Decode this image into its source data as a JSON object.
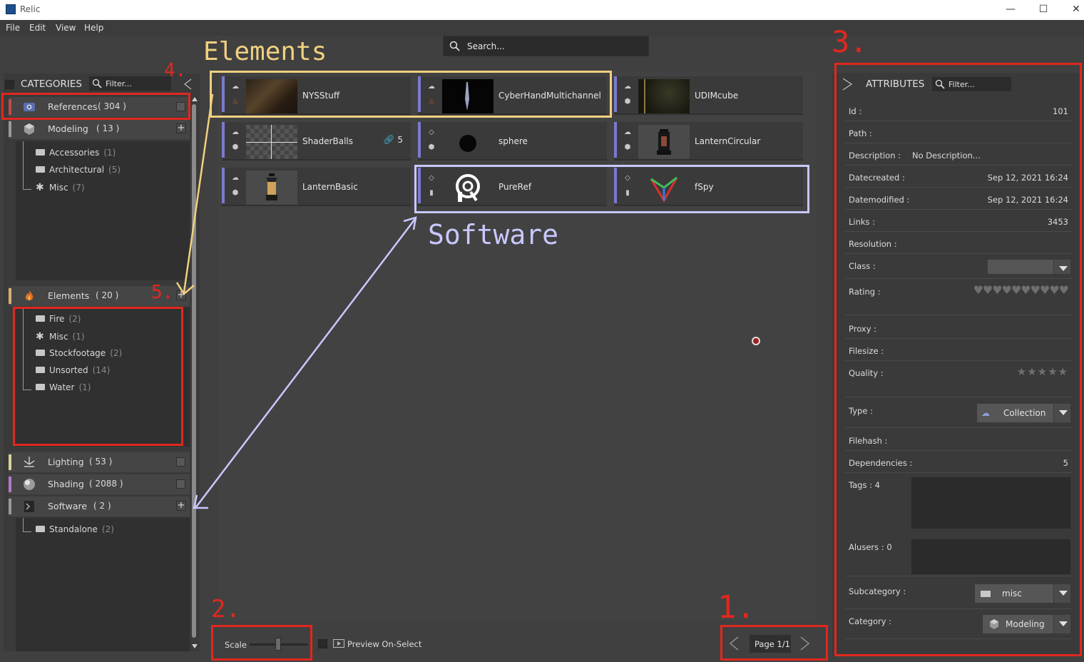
{
  "window": {
    "title": "Relic",
    "minimize": "—",
    "maximize": "☐",
    "close": "✕"
  },
  "menu": [
    "File",
    "Edit",
    "View",
    "Help"
  ],
  "search": {
    "placeholder": "Search..."
  },
  "categories_panel": {
    "title": "CATEGORIES",
    "filter_placeholder": "Filter...",
    "categories": [
      {
        "label": "References",
        "count": "( 304 )",
        "color": "#c44a4a",
        "expanded": false
      },
      {
        "label": "Modeling",
        "count": "( 13 )",
        "color": "#9a9a9a",
        "expanded": true,
        "subcategories": [
          {
            "label": "Accessories",
            "count": "(1)",
            "icon": "folder-icon"
          },
          {
            "label": "Architectural",
            "count": "(5)",
            "icon": "folder-icon"
          },
          {
            "label": "Misc",
            "count": "(7)",
            "icon": "asterisk-icon"
          }
        ]
      },
      {
        "label": "Elements",
        "count": "( 20 )",
        "color": "#d9b070",
        "expanded": true,
        "subcategories": [
          {
            "label": "Fire",
            "count": "(2)",
            "icon": "folder-icon"
          },
          {
            "label": "Misc",
            "count": "(1)",
            "icon": "asterisk-icon"
          },
          {
            "label": "Stockfootage",
            "count": "(2)",
            "icon": "folder-icon"
          },
          {
            "label": "Unsorted",
            "count": "(14)",
            "icon": "folder-icon"
          },
          {
            "label": "Water",
            "count": "(1)",
            "icon": "folder-icon"
          }
        ]
      },
      {
        "label": "Lighting",
        "count": "( 53 )",
        "color": "#d9d39a",
        "expanded": false
      },
      {
        "label": "Shading",
        "count": "( 2088 )",
        "color": "#b37ac9",
        "expanded": false
      },
      {
        "label": "Software",
        "count": "( 2 )",
        "color": "#9a9a9a",
        "expanded": true,
        "subcategories": [
          {
            "label": "Standalone",
            "count": "(2)",
            "icon": "folder-icon"
          }
        ]
      }
    ]
  },
  "assets": [
    {
      "name": "NYSStuff",
      "stripe": "#7a7ad0",
      "category_icon": "fire-icon"
    },
    {
      "name": "CyberHandMultichannel",
      "stripe": "#7a7ad0",
      "category_icon": "fire-icon"
    },
    {
      "name": "UDIMcube",
      "stripe": "#7a7ad0",
      "category_icon": "cube-icon"
    },
    {
      "name": "ShaderBalls",
      "stripe": "#7a7ad0",
      "category_icon": "cube-icon",
      "links": "5"
    },
    {
      "name": "sphere",
      "stripe": "#7a7ad0",
      "category_icon": "cube-icon"
    },
    {
      "name": "LanternCircular",
      "stripe": "#7a7ad0",
      "category_icon": "cube-icon"
    },
    {
      "name": "LanternBasic",
      "stripe": "#7a7ad0",
      "category_icon": "cube-icon"
    },
    {
      "name": "PureRef",
      "stripe": "#7a7ad0",
      "category_icon": "software-icon"
    },
    {
      "name": "fSpy",
      "stripe": "#7a7ad0",
      "category_icon": "software-icon"
    }
  ],
  "bottom_bar": {
    "scale_label": "Scale",
    "scale_value": 0.5,
    "preview_label": "Preview On-Select",
    "page_label": "Page 1/1"
  },
  "attributes": {
    "title": "ATTRIBUTES",
    "filter_placeholder": "Filter...",
    "rows": [
      {
        "key": "Id :",
        "value": "101"
      },
      {
        "key": "Path :",
        "value": ""
      },
      {
        "key": "Description :",
        "value": "No Description..."
      },
      {
        "key": "Datecreated :",
        "value": "Sep 12, 2021 16:24"
      },
      {
        "key": "Datemodified :",
        "value": "Sep 12, 2021 16:24"
      },
      {
        "key": "Links :",
        "value": "3453"
      },
      {
        "key": "Resolution :",
        "value": ""
      },
      {
        "key": "Class :",
        "value": ""
      },
      {
        "key": "Rating :",
        "value": ""
      },
      {
        "key": "Proxy :",
        "value": ""
      },
      {
        "key": "Filesize :",
        "value": ""
      },
      {
        "key": "Quality :",
        "value": ""
      },
      {
        "key": "Type :",
        "value": "Collection"
      },
      {
        "key": "Filehash :",
        "value": ""
      },
      {
        "key": "Dependencies :",
        "value": "5"
      },
      {
        "key": "Tags : 4",
        "value": ""
      },
      {
        "key": "Alusers : 0",
        "value": ""
      },
      {
        "key": "Subcategory :",
        "value": "misc"
      },
      {
        "key": "Category :",
        "value": "Modeling"
      }
    ],
    "rating_hearts": "♥♥♥♥♥♥♥♥♥♥",
    "rating_value": 0,
    "quality_stars": "★★★★★",
    "quality_value": 0
  },
  "annotations": {
    "elements_label": "Elements",
    "software_label": "Software",
    "n1": "1.",
    "n2": "2.",
    "n3": "3.",
    "n4": "4.",
    "n5": "5."
  },
  "colors": {
    "annotation_red": "#e0281e",
    "elements_box": "#f0d080",
    "software_box": "#c8c8ff"
  }
}
